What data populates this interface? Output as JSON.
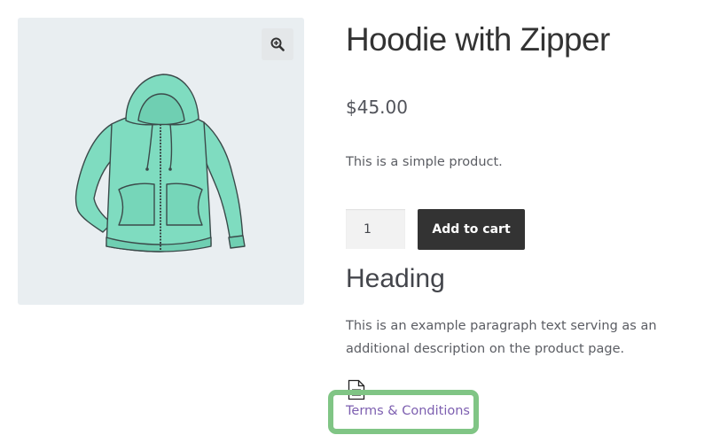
{
  "product": {
    "title": "Hoodie with Zipper",
    "price": "$45.00",
    "short_description": "This is a simple product."
  },
  "gallery": {
    "zoom_icon": "magnifier-zoom-icon",
    "image": "hoodie-with-zipper-image"
  },
  "cart": {
    "quantity": "1",
    "add_to_cart_label": "Add to cart"
  },
  "description": {
    "heading": "Heading",
    "paragraph": "This is an example paragraph text serving as an additional description on the product page."
  },
  "attachment": {
    "icon": "document-icon",
    "link_text": "Terms & Conditions"
  },
  "colors": {
    "button_bg": "#333333",
    "link": "#7d5fb0",
    "highlight": "#80c585",
    "gallery_bg": "#e9eef1",
    "hoodie": "#7fdcc0"
  }
}
